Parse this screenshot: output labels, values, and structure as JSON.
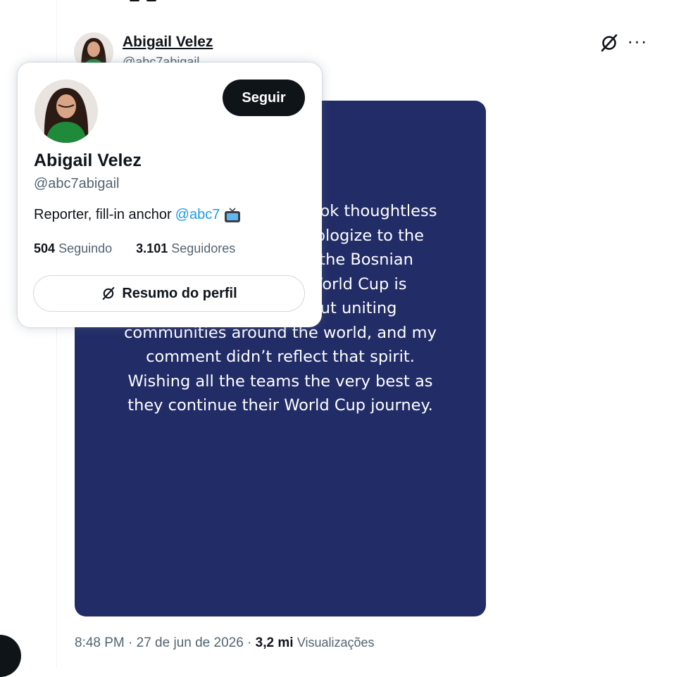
{
  "post": {
    "author_name": "Abigail Velez",
    "author_handle": "@abc7abigail",
    "statement_text": "ve a little fun etition, I took thoughtless hat was propriate. I apologize to the people of Bosnia and the Bosnian Football team. The World Cup is supposed to be about uniting communities around the world, and my comment didn’t reflect that spirit. Wishing all the teams the very best as they continue their World Cup journey.",
    "timestamp": "8:48 PM · 27 de jun de 2026 · ",
    "views_count": "3,2 mi",
    "views_label": "Visualizações"
  },
  "hovercard": {
    "follow_label": "Seguir",
    "name": "Abigail Velez",
    "handle": "@abc7abigail",
    "bio_text": "Reporter, fill-in anchor",
    "bio_mention": "@abc7",
    "following_count": "504",
    "following_label": "Seguindo",
    "followers_count": "3.101",
    "followers_label": "Seguidores",
    "profile_summary_label": "Resumo do perfil"
  },
  "icons": {
    "grok": "grok-icon",
    "more": "more-icon",
    "tv": "tv-icon"
  },
  "colors": {
    "media_background": "#222c67",
    "link": "#1d9bf0",
    "follow_button": "#0f1419",
    "secondary_text": "#536471"
  }
}
